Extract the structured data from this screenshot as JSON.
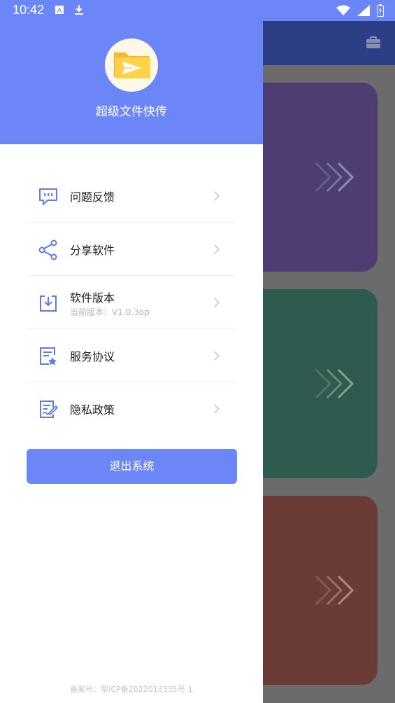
{
  "status_bar": {
    "time": "10:42"
  },
  "app": {
    "name": "超级文件快传",
    "colors": {
      "primary": "#6b87f7",
      "card1": "#4e3d72",
      "card2": "#2f5a4f",
      "card3": "#6b3c35"
    }
  },
  "menu": {
    "items": [
      {
        "label": "问题反馈",
        "icon": "feedback-icon"
      },
      {
        "label": "分享软件",
        "icon": "share-icon"
      },
      {
        "label": "软件版本",
        "sub": "当前版本：V1.0.3op",
        "icon": "download-box-icon"
      },
      {
        "label": "服务协议",
        "icon": "agreement-icon"
      },
      {
        "label": "隐私政策",
        "icon": "privacy-icon"
      }
    ]
  },
  "logout": {
    "label": "退出系统"
  },
  "footer": {
    "icp": "备案号：鄂ICP备2022013335号-1"
  }
}
